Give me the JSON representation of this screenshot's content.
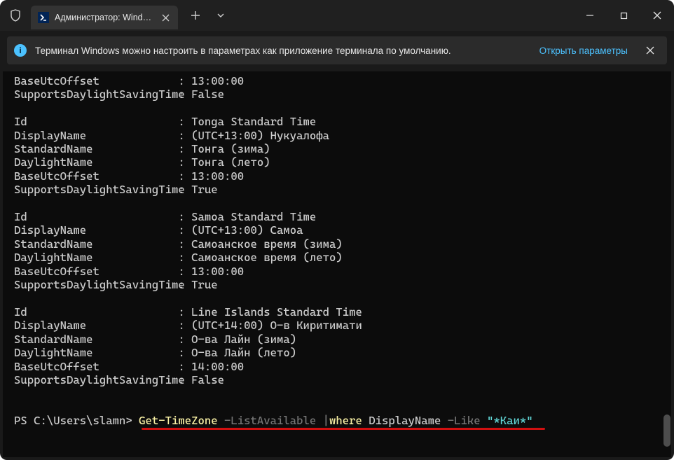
{
  "titlebar": {
    "tab_title": "Администратор: Windows Pc"
  },
  "infobar": {
    "text": "Терминал Windows можно настроить в параметрах как приложение терминала по умолчанию.",
    "link": "Открыть параметры"
  },
  "output": {
    "top": [
      {
        "k": "BaseUtcOffset",
        "v": "13:00:00"
      },
      {
        "k": "SupportsDaylightSavingTime",
        "v": "False"
      }
    ],
    "groups": [
      [
        {
          "k": "Id",
          "v": "Tonga Standard Time"
        },
        {
          "k": "DisplayName",
          "v": "(UTC+13:00) Нукуалофа"
        },
        {
          "k": "StandardName",
          "v": "Тонга (зима)"
        },
        {
          "k": "DaylightName",
          "v": "Тонга (лето)"
        },
        {
          "k": "BaseUtcOffset",
          "v": "13:00:00"
        },
        {
          "k": "SupportsDaylightSavingTime",
          "v": "True"
        }
      ],
      [
        {
          "k": "Id",
          "v": "Samoa Standard Time"
        },
        {
          "k": "DisplayName",
          "v": "(UTC+13:00) Самоа"
        },
        {
          "k": "StandardName",
          "v": "Самоанское время (зима)"
        },
        {
          "k": "DaylightName",
          "v": "Самоанское время (лето)"
        },
        {
          "k": "BaseUtcOffset",
          "v": "13:00:00"
        },
        {
          "k": "SupportsDaylightSavingTime",
          "v": "True"
        }
      ],
      [
        {
          "k": "Id",
          "v": "Line Islands Standard Time"
        },
        {
          "k": "DisplayName",
          "v": "(UTC+14:00) О-в Киритимати"
        },
        {
          "k": "StandardName",
          "v": "О-ва Лайн (зима)"
        },
        {
          "k": "DaylightName",
          "v": "О-ва Лайн (лето)"
        },
        {
          "k": "BaseUtcOffset",
          "v": "14:00:00"
        },
        {
          "k": "SupportsDaylightSavingTime",
          "v": "False"
        }
      ]
    ]
  },
  "prompt": {
    "ps": "PS C:\\Users\\slamn> ",
    "cmd1": "Get-TimeZone",
    "arg1": " -ListAvailable ",
    "pipe": "|",
    "cmd2": "where",
    "arg2": " DisplayName ",
    "like": "-Like",
    "str": " \"*Каи*\""
  }
}
